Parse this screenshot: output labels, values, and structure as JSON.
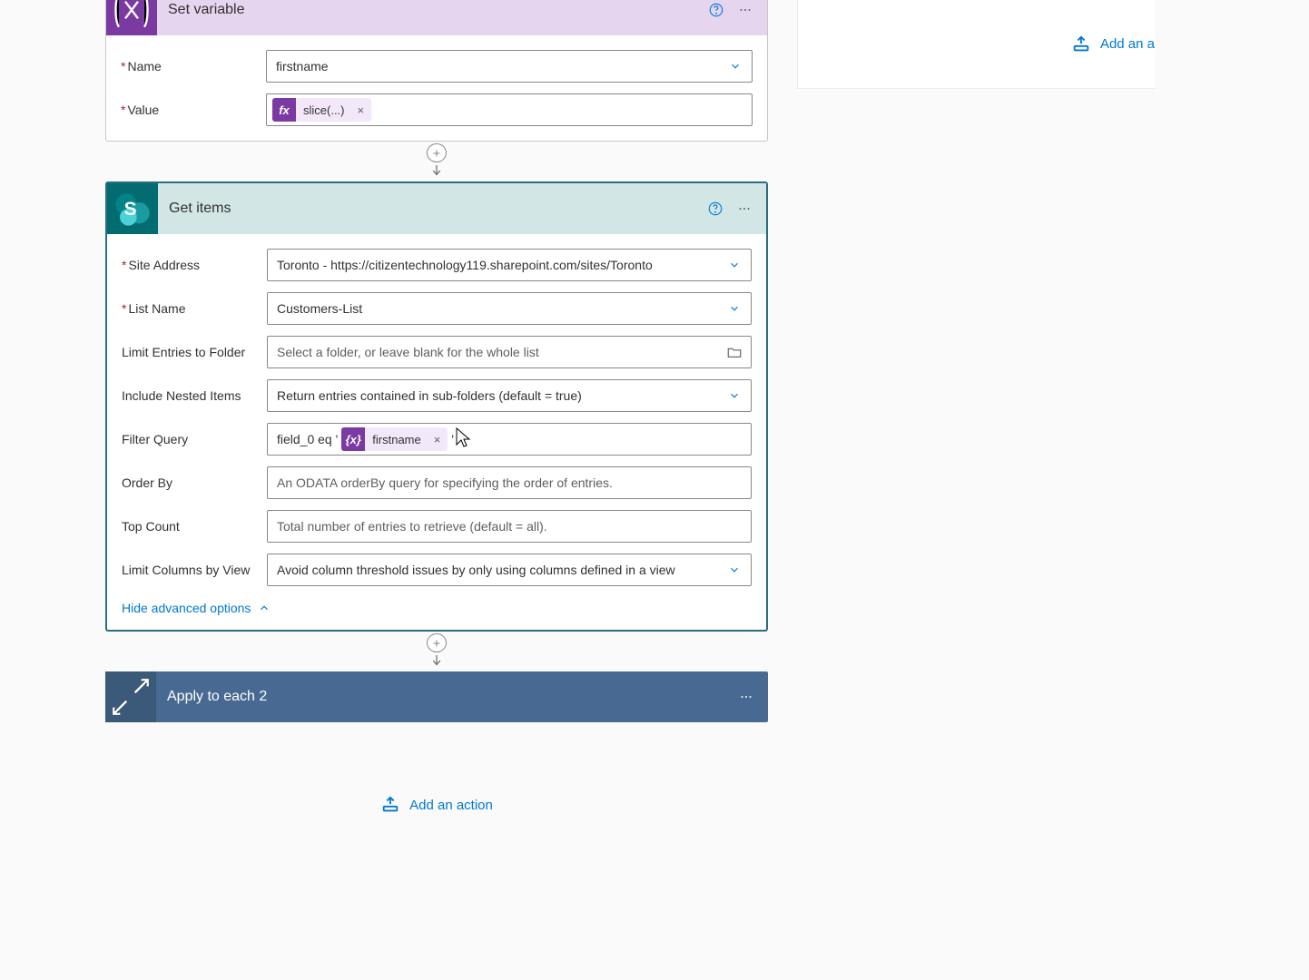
{
  "set_variable": {
    "title": "Set variable",
    "name_label": "Name",
    "name_value": "firstname",
    "value_label": "Value",
    "value_token_icon": "fx",
    "value_token_label": "slice(...)"
  },
  "get_items": {
    "title": "Get items",
    "site_label": "Site Address",
    "site_value": "Toronto - https://citizentechnology119.sharepoint.com/sites/Toronto",
    "list_label": "List Name",
    "list_value": "Customers-List",
    "limit_folder_label": "Limit Entries to Folder",
    "limit_folder_ph": "Select a folder, or leave blank for the whole list",
    "nested_label": "Include Nested Items",
    "nested_value": "Return entries contained in sub-folders (default = true)",
    "filter_label": "Filter Query",
    "filter_prefix": "field_0 eq '",
    "filter_token_icon": "{x}",
    "filter_token_label": "firstname",
    "filter_suffix": "'",
    "orderby_label": "Order By",
    "orderby_ph": "An ODATA orderBy query for specifying the order of entries.",
    "top_label": "Top Count",
    "top_ph": "Total number of entries to retrieve (default = all).",
    "limit_cols_label": "Limit Columns by View",
    "limit_cols_value": "Avoid column threshold issues by only using columns defined in a view",
    "hide_advanced": "Hide advanced options"
  },
  "apply_each": {
    "title": "Apply to each 2"
  },
  "buttons": {
    "add_action": "Add an action",
    "add_action_right": "Add an a"
  }
}
